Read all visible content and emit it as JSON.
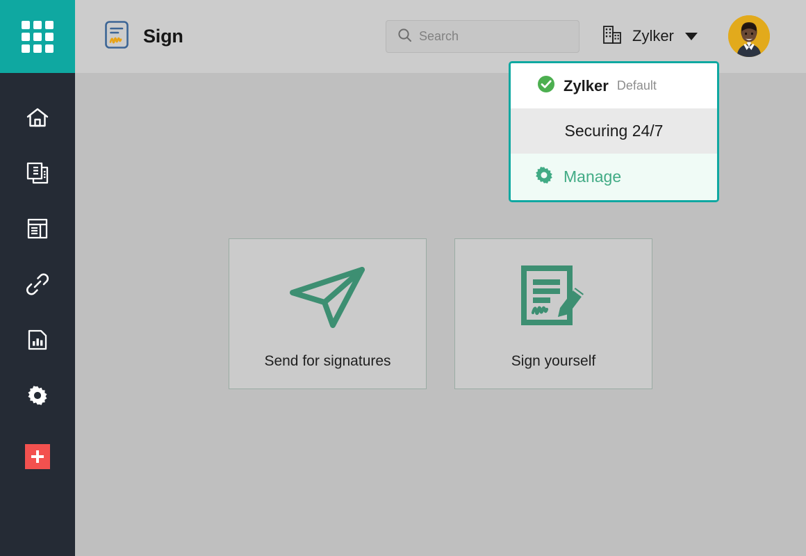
{
  "app": {
    "brand_title": "Sign",
    "app_switcher_icon": "grid-apps-icon",
    "brand_logo_icon": "sign-document-logo-icon"
  },
  "sidebar": {
    "items": [
      {
        "icon": "home-icon",
        "name": "home"
      },
      {
        "icon": "documents-icon",
        "name": "documents"
      },
      {
        "icon": "templates-icon",
        "name": "templates"
      },
      {
        "icon": "link-icon",
        "name": "links"
      },
      {
        "icon": "reports-icon",
        "name": "reports"
      },
      {
        "icon": "settings-gear-icon",
        "name": "settings"
      }
    ],
    "create_button": {
      "icon": "plus-icon",
      "name": "create"
    }
  },
  "header": {
    "search": {
      "icon": "search-icon",
      "placeholder": "Search",
      "value": ""
    },
    "org_picker": {
      "icon": "building-icon",
      "label": "Zylker",
      "caret_icon": "chevron-down-icon"
    },
    "avatar": {
      "name": "user-avatar",
      "background": "#e2aa1c"
    }
  },
  "org_dropdown": {
    "organization": {
      "name": "Zylker",
      "badge": "Default",
      "check_icon": "check-circle-icon"
    },
    "secondary": {
      "label": "Securing 24/7"
    },
    "manage": {
      "icon": "gear-icon",
      "label": "Manage"
    }
  },
  "main": {
    "cards": [
      {
        "icon": "paper-plane-icon",
        "label": "Send for signatures"
      },
      {
        "icon": "sign-document-pencil-icon",
        "label": "Sign yourself"
      }
    ]
  },
  "colors": {
    "teal": "#0fa8a1",
    "sidebar": "#252b35",
    "header": "#cccccc",
    "body": "#bfbfbf",
    "accent_green": "#41ab85",
    "check_green": "#4caf50",
    "create_red": "#f3514f"
  }
}
